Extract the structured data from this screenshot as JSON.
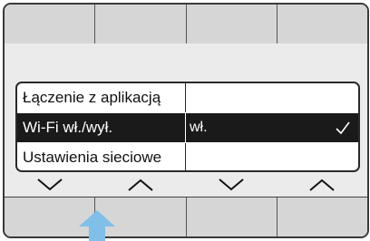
{
  "menu": {
    "items": [
      {
        "label": "Łączenie z aplikacją",
        "value": ""
      },
      {
        "label": "Wi-Fi wł./wył.",
        "value": "wł.",
        "selected": true
      },
      {
        "label": "Ustawienia sieciowe",
        "value": ""
      }
    ]
  },
  "navigation": {
    "arrows": [
      "chevron-down",
      "chevron-up",
      "chevron-down",
      "chevron-up"
    ]
  },
  "indicator": {
    "icon": "up-arrow-pointer",
    "color": "#7fbfe8"
  },
  "colors": {
    "selected_bg": "#1a1a1a",
    "softkey": "#d6d6d6"
  }
}
